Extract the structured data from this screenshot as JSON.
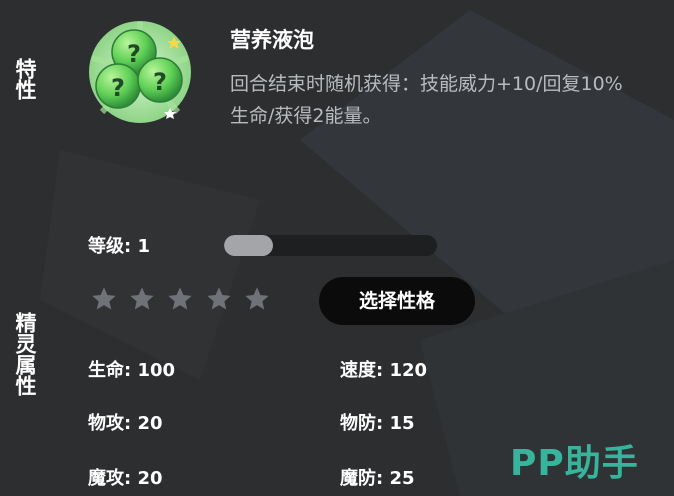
{
  "sections": {
    "trait_label": "特性",
    "attributes_label": "精灵属性"
  },
  "trait": {
    "name": "营养液泡",
    "description": "回合结束时随机获得：技能威力+10/回复10%生命/获得2能量。",
    "icon": "green-bubbles-icon"
  },
  "level": {
    "label": "等级",
    "value": "1",
    "progress_fraction": 0.23
  },
  "stars": {
    "total": 5,
    "filled": 0,
    "icon": "star-icon"
  },
  "nature_button": {
    "label": "选择性格"
  },
  "stats": {
    "hp": {
      "label": "生命",
      "value": "100"
    },
    "speed": {
      "label": "速度",
      "value": "120"
    },
    "attack": {
      "label": "物攻",
      "value": "20"
    },
    "defense": {
      "label": "物防",
      "value": "15"
    },
    "magic_attack": {
      "label": "魔攻",
      "value": "20"
    },
    "magic_defense": {
      "label": "魔防",
      "value": "25"
    }
  },
  "watermark": {
    "text": "PP助手"
  },
  "colors": {
    "background": "#2c2e30",
    "accent_green": "#37b59c",
    "button_bg": "#0b0b0b"
  }
}
